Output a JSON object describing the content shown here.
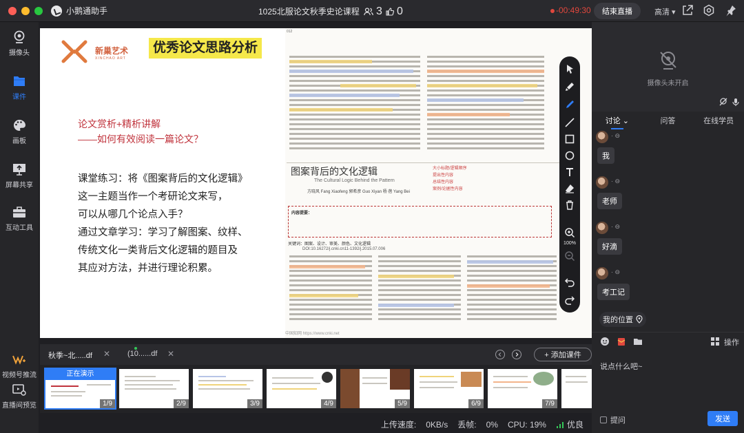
{
  "titlebar": {
    "app_name": "小鹅通助手",
    "course_title": "1025北服论文秋季史论课程",
    "people_count": "3",
    "like_count": "0",
    "timer": "-00:49:30",
    "end_live": "结束直播",
    "quality": "高清"
  },
  "sidebar": {
    "items": [
      {
        "label": "摄像头",
        "icon": "camera-icon"
      },
      {
        "label": "课件",
        "icon": "folder-icon"
      },
      {
        "label": "画板",
        "icon": "palette-icon"
      },
      {
        "label": "屏幕共享",
        "icon": "screen-share-icon"
      },
      {
        "label": "互动工具",
        "icon": "toolbox-icon"
      },
      {
        "label": "视频号推流",
        "icon": "wechat-channels-icon"
      },
      {
        "label": "直播间预览",
        "icon": "preview-icon"
      }
    ]
  },
  "slide": {
    "brand": "新巢艺术",
    "brand_sub": "XINCHAO ART",
    "title": "优秀论文思路分析",
    "red_line1": "论文赏析+精析讲解",
    "red_line2": "——如何有效阅读一篇论文？",
    "body_lines": [
      "课堂练习：将《图案背后的文化逻辑》",
      "这一主题当作一个考研论文来写，",
      "可以从哪几个论点入手？",
      "通过文章学习：学习了解图案、纹样、",
      "传统文化一类背后文化逻辑的题目及",
      "其应对方法，并进行理论积累。"
    ],
    "paper": {
      "page_no": "012",
      "title_cn": "图案背后的文化逻辑",
      "title_en": "The Cultural Logic Behind the Pattern",
      "authors": "方晓风  Fang Xiaofeng    郭希彦  Guo Xiyan    杨   蓓  Yang Bei",
      "annotations": [
        "大小标题/逻辑顺序",
        "提出性内容",
        "总结性内容",
        "案例/论据性内容"
      ],
      "abstract_label": "内容提要：",
      "keywords": "关键词：图案、设计、审美、颜色、文化逻辑",
      "doi": "DOI:10.16272/j.cnki.cn11-1392/j.2015.07.006",
      "watermark": "中国知网  https://www.cnki.net"
    }
  },
  "drawing_tools": {
    "zoom": "100%"
  },
  "files": {
    "tabs": [
      "秋季~北.....df",
      "(10......df"
    ],
    "add_course": "+ 添加课件",
    "presenting": "正在演示",
    "thumbs": [
      "1/9",
      "2/9",
      "3/9",
      "4/9",
      "5/9",
      "6/9",
      "7/9"
    ]
  },
  "status": {
    "upload_label": "上传速度:",
    "upload_value": "0KB/s",
    "drop_label": "丢帧:",
    "drop_value": "0%",
    "cpu": "CPU: 19%",
    "net_quality": "优良"
  },
  "panel": {
    "camera_off": "摄像头未开启",
    "tabs": [
      "讨论",
      "问答",
      "在线学员"
    ],
    "messages": [
      "我",
      "老师",
      "好滴",
      "考工记"
    ],
    "meta": "·",
    "my_location": "我的位置",
    "actions": "操作",
    "input_placeholder": "说点什么吧~",
    "ask_label": "提问",
    "send": "发送"
  },
  "colors": {
    "accent": "#2f7df6",
    "timer": "#e0473d",
    "slide_title_bg": "#f5e84a",
    "slide_red": "#c0333c"
  }
}
